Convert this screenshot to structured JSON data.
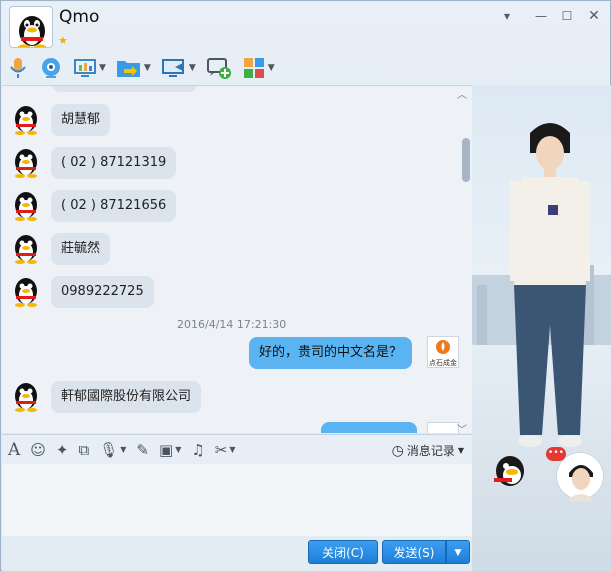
{
  "window": {
    "title": "Qmo",
    "controls": [
      "minimize",
      "maximize",
      "close"
    ]
  },
  "toolbar": {
    "icons": [
      "microphone-icon",
      "webcam-icon",
      "screen-share-icon",
      "file-transfer-icon",
      "remote-desktop-icon",
      "create-group-icon",
      "app-grid-icon"
    ]
  },
  "chat": {
    "messages": [
      {
        "side": "left",
        "text": "胡慧郁"
      },
      {
        "side": "left",
        "text": "( 02 ) 87121319"
      },
      {
        "side": "left",
        "text": "( 02 ) 87121656"
      },
      {
        "side": "left",
        "text": "莊毓然"
      },
      {
        "side": "left",
        "text": "0989222725"
      },
      {
        "side": "right",
        "text": "好的，贵司的中文名是？"
      },
      {
        "side": "left",
        "text": "軒郁國際股份有限公司"
      }
    ],
    "timestamp": "2016/4/14 17:21:30",
    "right_avatar_label": "点石成金"
  },
  "input_toolbar": {
    "history_label": "消息记录"
  },
  "buttons": {
    "close": "关闭(C)",
    "send": "发送(S)"
  },
  "colors": {
    "send_blue": "#1c7fd9",
    "my_bubble": "#59b4f1",
    "their_bubble": "#dbe3ec"
  }
}
